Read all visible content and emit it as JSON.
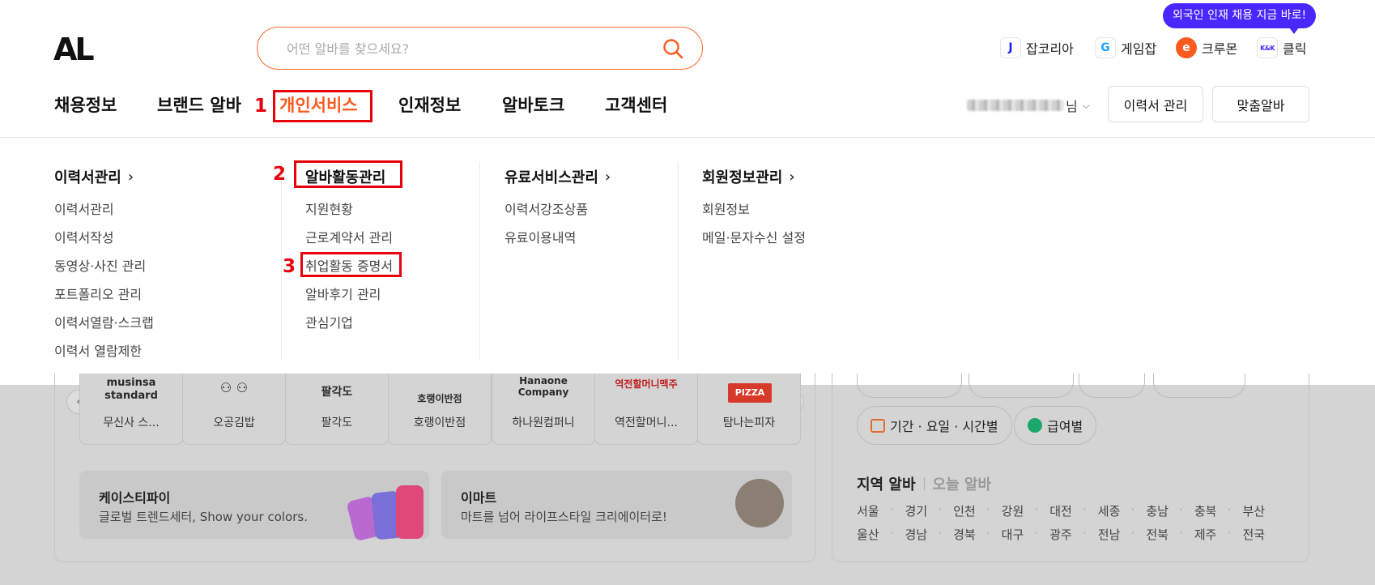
{
  "header": {
    "logo_text": "AL",
    "search_placeholder": "어떤 알바를 찾으세요?",
    "tooltip": "외국인 인재 채용 지금 바로!",
    "family_sites": [
      {
        "badge": "J",
        "label": "잡코리아",
        "color": "#1a1aff"
      },
      {
        "badge": "G",
        "label": "게임잡",
        "color": "#1aa3ff"
      },
      {
        "badge": "e",
        "label": "크루몬",
        "color": "#ff5a1f"
      },
      {
        "badge": "K&K",
        "label": "클릭",
        "color": "#4b27ff"
      }
    ],
    "gnb": [
      "채용정보",
      "브랜드 알바",
      "개인서비스",
      "인재정보",
      "알바토크",
      "고객센터"
    ],
    "user_suffix": "님",
    "resume_manage_btn": "이력서 관리",
    "custom_alba_btn": "맞춤알바"
  },
  "annotations": {
    "step1": "1",
    "step2": "2",
    "step3": "3"
  },
  "dropdown": {
    "columns": [
      {
        "title": "이력서관리",
        "arrow": true,
        "items": [
          "이력서관리",
          "이력서작성",
          "동영상·사진 관리",
          "포트폴리오 관리",
          "이력서열람·스크랩",
          "이력서 열람제한"
        ]
      },
      {
        "title": "알바활동관리",
        "arrow": false,
        "items": [
          "지원현황",
          "근로계약서 관리",
          "취업활동 증명서",
          "알바후기 관리",
          "관심기업"
        ]
      },
      {
        "title": "유료서비스관리",
        "arrow": true,
        "items": [
          "이력서강조상품",
          "유료이용내역"
        ]
      },
      {
        "title": "회원정보관리",
        "arrow": true,
        "items": [
          "회원정보",
          "메일·문자수신 설정"
        ]
      }
    ]
  },
  "background": {
    "brands": [
      {
        "logo": "musinsa standard",
        "name": "무신사 스..."
      },
      {
        "logo": "⚇ ⚇",
        "name": "오공김밥"
      },
      {
        "logo": "팔각도",
        "name": "팔각도"
      },
      {
        "logo": "호랭이반점",
        "name": "호랭이반점"
      },
      {
        "logo": "Hanaone Company",
        "name": "하나원컴퍼니"
      },
      {
        "logo": "역전할머니맥주",
        "name": "역전할머니..."
      },
      {
        "logo": "PIZZA",
        "name": "탐나는피자"
      }
    ],
    "banners": [
      {
        "title": "케이스티파이",
        "subtitle": "글로벌 트렌드세터, Show your colors."
      },
      {
        "title": "이마트",
        "subtitle": "마트를 넘어 라이프스타일 크리에이터로!"
      }
    ],
    "filters": [
      "기간 · 요일 · 시간별",
      "급여별"
    ],
    "region_tabs": [
      "지역 알바",
      "오늘 알바"
    ],
    "regions": [
      "서울",
      "경기",
      "인천",
      "강원",
      "대전",
      "세종",
      "충남",
      "충북",
      "부산",
      "울산",
      "경남",
      "경북",
      "대구",
      "광주",
      "전남",
      "전북",
      "제주",
      "전국"
    ]
  }
}
